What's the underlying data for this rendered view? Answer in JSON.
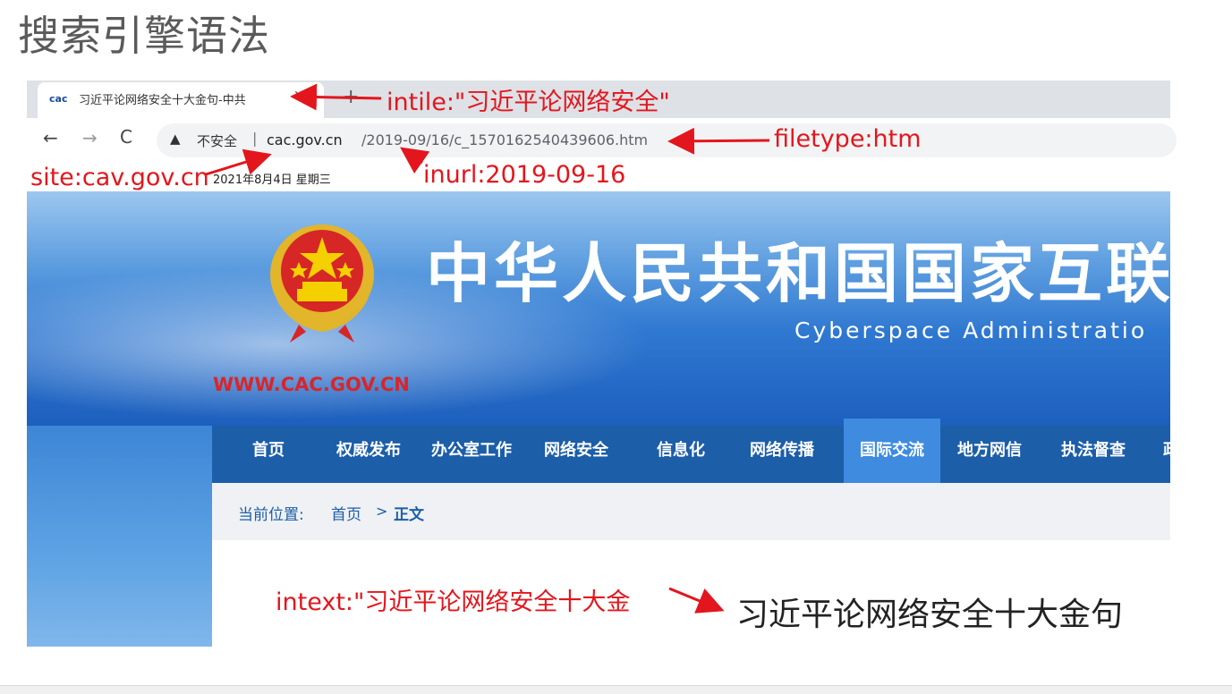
{
  "slide": {
    "title": "搜索引擎语法"
  },
  "browser": {
    "tab_title": "习近平论网络安全十大金句-中共",
    "favicon_text": "cac",
    "tab_close": "✕",
    "new_tab": "+",
    "back": "←",
    "forward": "→",
    "reload": "C",
    "security_icon": "▲",
    "security_label": "不安全",
    "url_separator": "|",
    "url_domain": "cac.gov.cn",
    "url_path": "/2019-09/16/c_1570162540439606.htm"
  },
  "page": {
    "date": "2021年8月4日 星期三",
    "site_name_cn": "中华人民共和国国家互联",
    "site_name_en": "Cyberspace Administratio",
    "site_url": "WWW.CAC.GOV.CN",
    "nav": [
      "首页",
      "权威发布",
      "办公室工作",
      "网络安全",
      "信息化",
      "网络传播",
      "国际交流",
      "地方网信",
      "执法督查",
      "政"
    ],
    "nav_active_index": 6,
    "breadcrumb": {
      "label": "当前位置:",
      "home": "首页",
      "separator": ">",
      "current": "正文"
    },
    "article_title": "习近平论网络安全十大金句"
  },
  "annotations": {
    "intitle": "intile:\"习近平论网络安全\"",
    "filetype": "filetype:htm",
    "site": "site:cav.gov.cn",
    "inurl": "inurl:2019-09-16",
    "intext": "intext:\"习近平论网络安全十大金"
  },
  "colors": {
    "annotation": "#e3161d",
    "nav_bg": "#1c5ea8",
    "nav_active": "#3e8be0",
    "site_url": "#d7262b"
  },
  "icons": [
    "warning-triangle-icon",
    "back-arrow-icon",
    "forward-arrow-icon",
    "reload-icon",
    "close-icon",
    "new-tab-icon",
    "national-emblem-icon"
  ]
}
